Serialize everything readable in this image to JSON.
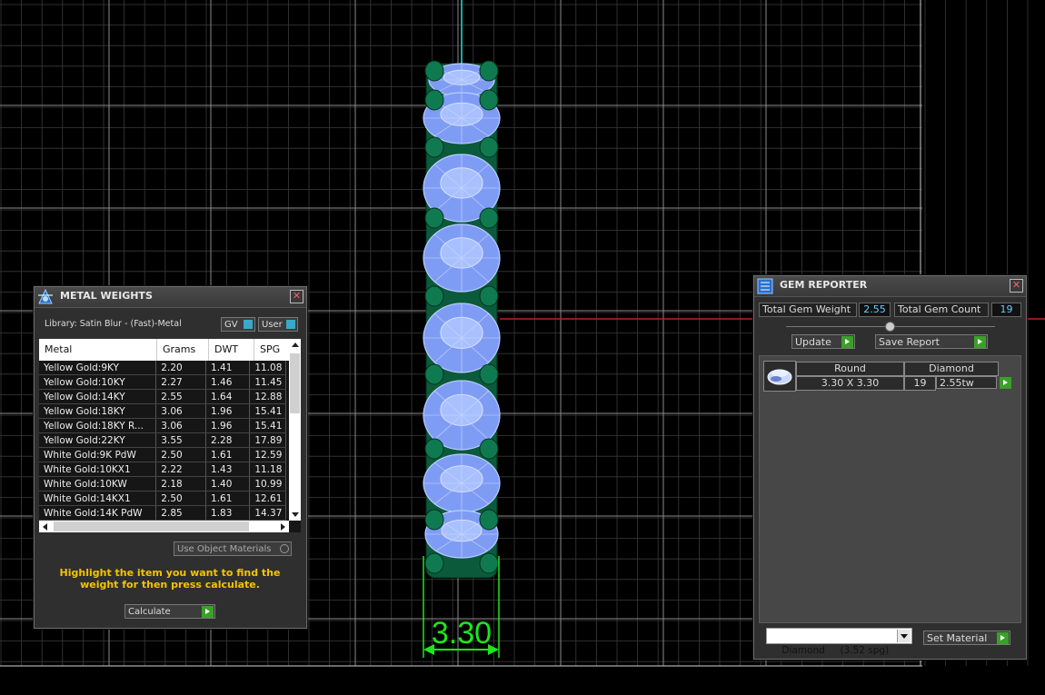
{
  "viewport": {
    "dimension_label": "3.30"
  },
  "metal_weights": {
    "title": "METAL WEIGHTS",
    "library_label": "Library: Satin Blur - (Fast)-Metal",
    "gv_label": "GV",
    "user_label": "User",
    "columns": [
      "Metal",
      "Grams",
      "DWT",
      "SPG"
    ],
    "rows": [
      {
        "metal": "Yellow Gold:9KY",
        "grams": "2.20",
        "dwt": "1.41",
        "spg": "11.08"
      },
      {
        "metal": "Yellow Gold:10KY",
        "grams": "2.27",
        "dwt": "1.46",
        "spg": "11.45"
      },
      {
        "metal": "Yellow Gold:14KY",
        "grams": "2.55",
        "dwt": "1.64",
        "spg": "12.88"
      },
      {
        "metal": "Yellow Gold:18KY",
        "grams": "3.06",
        "dwt": "1.96",
        "spg": "15.41"
      },
      {
        "metal": "Yellow Gold:18KY R...",
        "grams": "3.06",
        "dwt": "1.96",
        "spg": "15.41"
      },
      {
        "metal": "Yellow Gold:22KY",
        "grams": "3.55",
        "dwt": "2.28",
        "spg": "17.89"
      },
      {
        "metal": "White Gold:9K PdW",
        "grams": "2.50",
        "dwt": "1.61",
        "spg": "12.59"
      },
      {
        "metal": "White Gold:10KX1",
        "grams": "2.22",
        "dwt": "1.43",
        "spg": "11.18"
      },
      {
        "metal": "White Gold:10KW",
        "grams": "2.18",
        "dwt": "1.40",
        "spg": "10.99"
      },
      {
        "metal": "White Gold:14KX1",
        "grams": "2.50",
        "dwt": "1.61",
        "spg": "12.61"
      },
      {
        "metal": "White Gold:14K PdW",
        "grams": "2.85",
        "dwt": "1.83",
        "spg": "14.37"
      }
    ],
    "use_object_materials_label": "Use Object Materials",
    "instruction": "Highlight the item you want to find the weight for then press calculate.",
    "calculate_label": "Calculate"
  },
  "gem_reporter": {
    "title": "GEM REPORTER",
    "total_weight_label": "Total Gem Weight",
    "total_weight_value": "2.55",
    "total_count_label": "Total Gem Count",
    "total_count_value": "19",
    "update_label": "Update",
    "save_report_label": "Save Report",
    "gem_row": {
      "shape": "Round",
      "size": "3.30 X 3.30",
      "material": "Diamond",
      "count": "19",
      "weight": "2.55tw"
    },
    "material_select_value": "Diamond     (3.52 spg)",
    "set_material_label": "Set Material"
  },
  "colors": {
    "accent_green": "#3aa02a",
    "highlight_yellow": "#f5c400",
    "value_cyan": "#66ccff",
    "dimension_green": "#1ee61e"
  }
}
